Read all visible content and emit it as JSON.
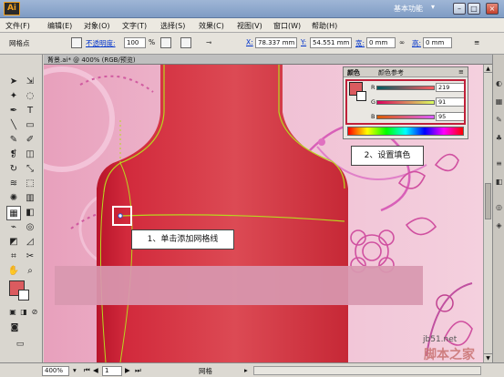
{
  "app": {
    "logo": "Ai",
    "workspace": "基本功能"
  },
  "menu": [
    "文件(F)",
    "编辑(E)",
    "对象(O)",
    "文字(T)",
    "选择(S)",
    "效果(C)",
    "视图(V)",
    "窗口(W)",
    "帮助(H)"
  ],
  "control": {
    "tool_label": "网格点",
    "opacity_label": "不透明度:",
    "opacity_value": "100",
    "opacity_unit": "%",
    "x_label": "X:",
    "x_value": "78.337 mm",
    "y_label": "Y:",
    "y_value": "54.551 mm",
    "w_label": "宽:",
    "w_value": "0 mm",
    "h_label": "高:",
    "h_value": "0 mm"
  },
  "document": {
    "tab_title": "背景.ai* @ 400% (RGB/预览)",
    "close": "×"
  },
  "color_panel": {
    "tabs": [
      "颜色",
      "颜色参考"
    ],
    "channels": [
      {
        "name": "R",
        "value": "219"
      },
      {
        "name": "G",
        "value": "91"
      },
      {
        "name": "B",
        "value": "95"
      }
    ],
    "fill_color": "#db5b5f"
  },
  "annotations": {
    "step1": "1、单击添加网格线",
    "step2": "2、设置填色"
  },
  "status": {
    "zoom": "400%",
    "page": "1",
    "tool": "网格"
  },
  "watermark": {
    "site": "jb51.net",
    "name": "脚本之家"
  }
}
